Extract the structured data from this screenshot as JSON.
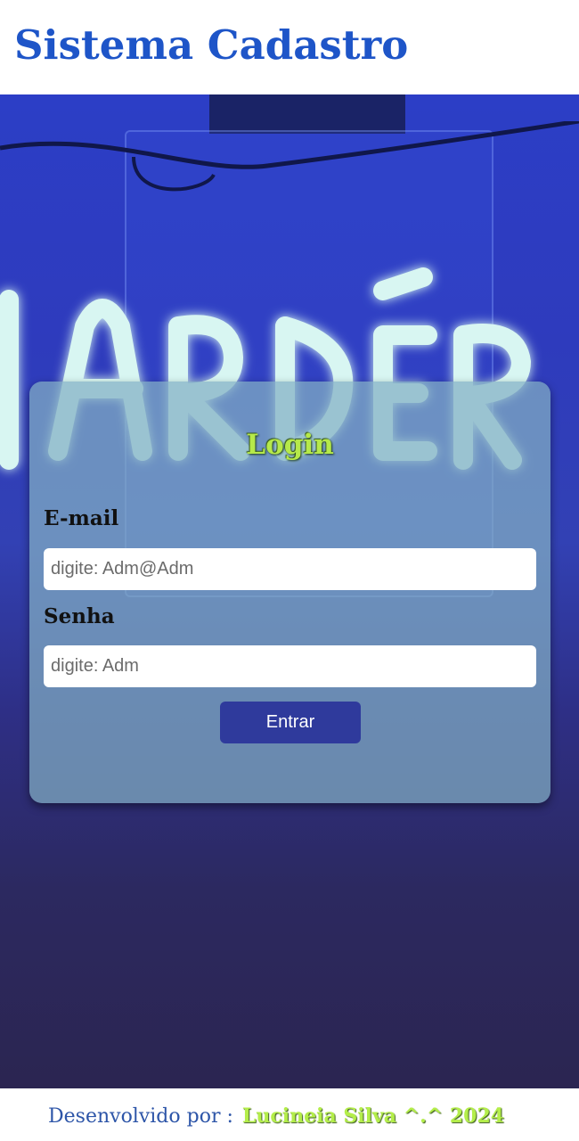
{
  "header": {
    "title": "Sistema Cadastro"
  },
  "login": {
    "title": "Login",
    "email_label": "E-mail",
    "email_placeholder": "digite: Adm@Adm",
    "password_label": "Senha",
    "password_placeholder": "digite: Adm",
    "submit_label": "Entrar"
  },
  "footer": {
    "label": "Desenvolvido por :",
    "author": "Lucineia Silva ^.^ 2024"
  },
  "colors": {
    "title_blue": "#1e55c8",
    "button_bg": "#2f3a9c",
    "accent_green": "#b4ee4a",
    "footer_blue": "#2d55a8"
  },
  "icons": {
    "hero_background": "neon-sign-image"
  }
}
